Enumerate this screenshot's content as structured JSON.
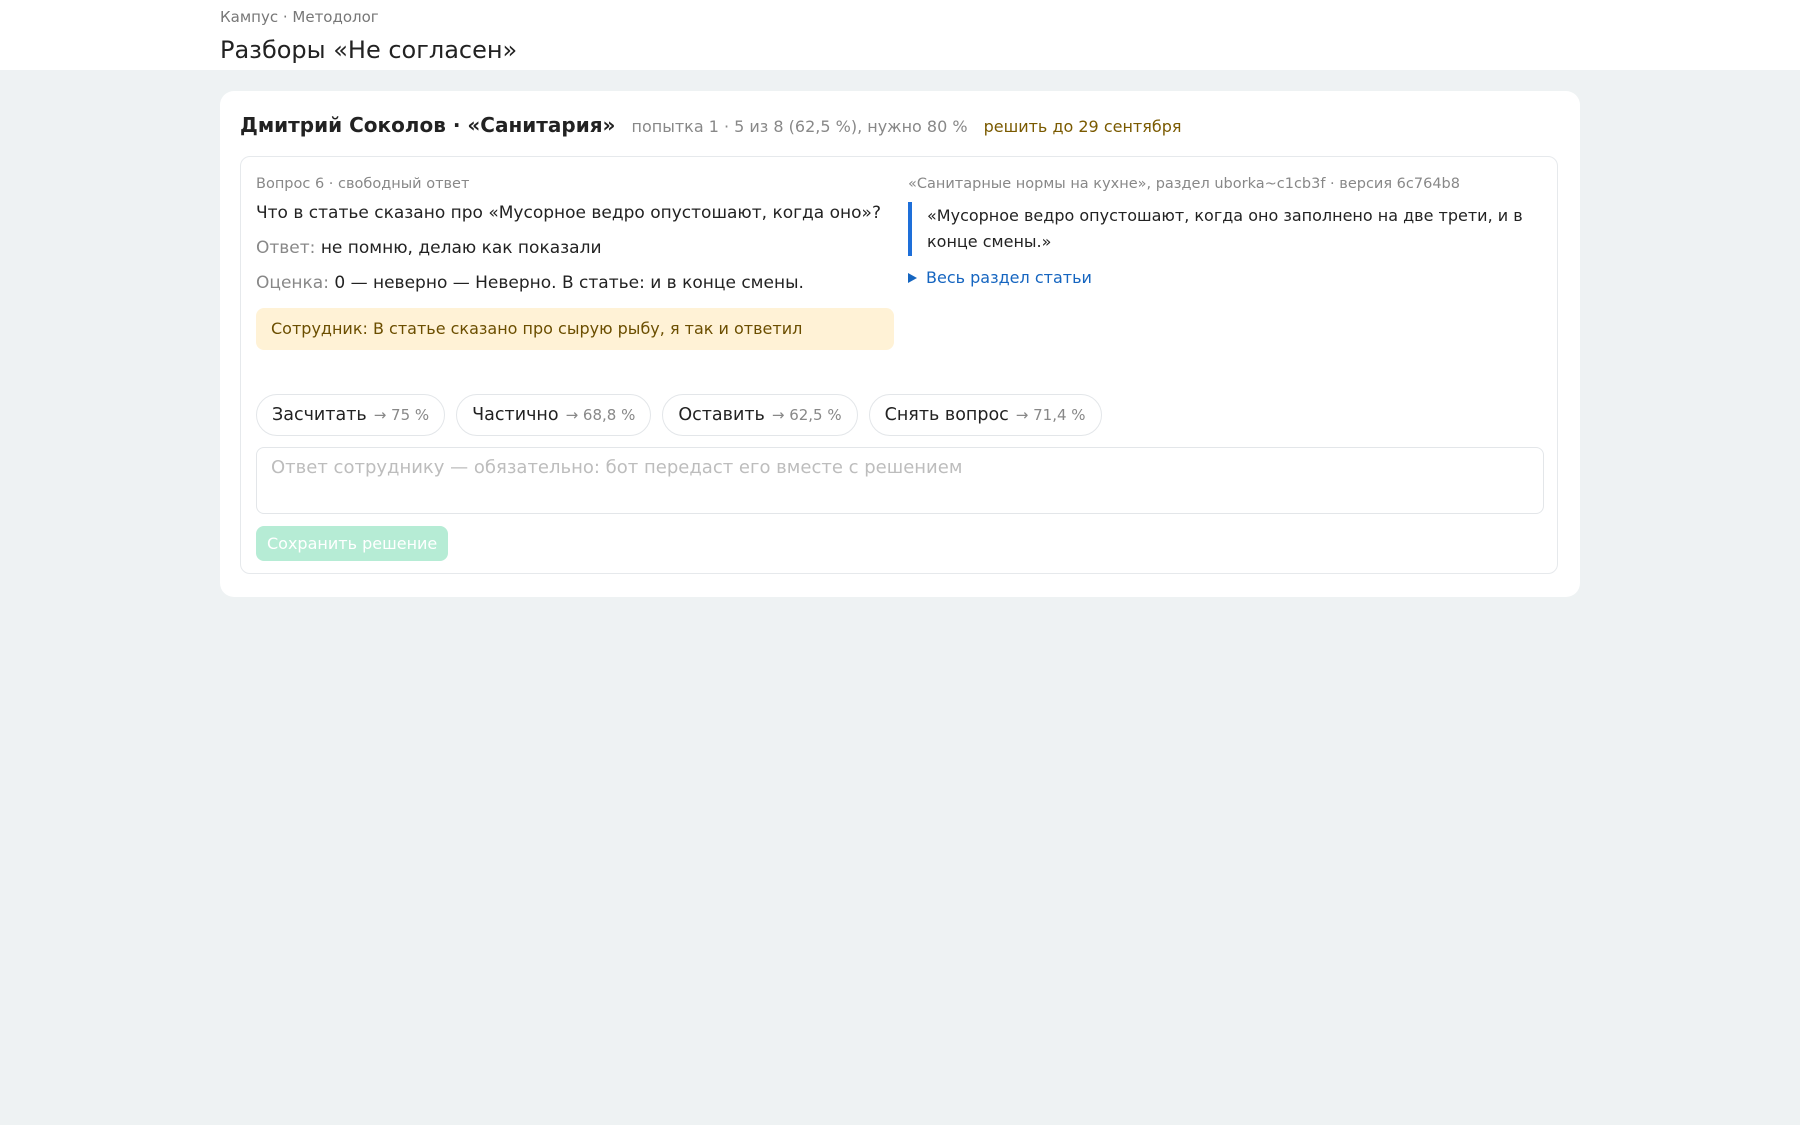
{
  "header": {
    "breadcrumb": "Кампус · Методолог",
    "title": "Разборы «Не согласен»"
  },
  "case": {
    "title": "Дмитрий Соколов · «Санитария»",
    "meta": "попытка 1 · 5 из 8 (62,5 %), нужно 80 %",
    "deadline": "решить до 29 сентября",
    "question_label": "Вопрос 6 · свободный ответ",
    "question": "Что в статье сказано про «Мусорное ведро опустошают, когда оно»?",
    "answer_label": "Ответ:",
    "answer": "не помню, делаю как показали",
    "grade_label": "Оценка:",
    "grade": "0 — неверно — Неверно. В статье: и в конце смены.",
    "complaint": "Сотрудник: В статье сказано про сырую рыбу, я так и ответил",
    "source": "«Санитарные нормы на кухне», раздел uborka~c1cb3f · версия 6c764b8",
    "quote": "«Мусорное ведро опустошают, когда оно заполнено на две трети, и в конце смены.»",
    "toggle_label": "Весь раздел статьи"
  },
  "decisions": [
    {
      "label": "Засчитать",
      "result": "→ 75 %"
    },
    {
      "label": "Частично",
      "result": "→ 68,8 %"
    },
    {
      "label": "Оставить",
      "result": "→ 62,5 %"
    },
    {
      "label": "Снять вопрос",
      "result": "→ 71,4 %"
    }
  ],
  "reply": {
    "placeholder": "Ответ сотруднику — обязательно: бот передаст его вместе с решением",
    "value": ""
  },
  "save_label": "Сохранить решение",
  "colors": {
    "accent_blue": "#1e6fd9",
    "link": "#1565c0",
    "warning_bg": "#fff2d6",
    "save_disabled": "#b6ecd5"
  }
}
